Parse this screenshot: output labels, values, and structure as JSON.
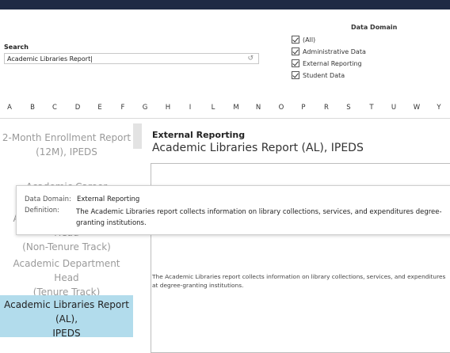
{
  "search": {
    "label": "Search",
    "value": "Academic Libraries Report",
    "reset_icon": "refresh-icon"
  },
  "domain_filter": {
    "title": "Data Domain",
    "options": [
      {
        "label": "(All)",
        "checked": true
      },
      {
        "label": "Administrative Data",
        "checked": true
      },
      {
        "label": "External Reporting",
        "checked": true
      },
      {
        "label": "Student Data",
        "checked": true
      }
    ]
  },
  "alphabet": [
    "A",
    "B",
    "C",
    "D",
    "E",
    "F",
    "G",
    "H",
    "I",
    "L",
    "M",
    "N",
    "O",
    "P",
    "R",
    "S",
    "T",
    "U",
    "W",
    "Y"
  ],
  "report_list": [
    {
      "line1": "2-Month Enrollment Report",
      "line2": "(12M), IPEDS"
    },
    {
      "line1": "Academic Career",
      "line2": ""
    },
    {
      "line1": "Academic Department Head",
      "line2": "(Non-Tenure Track)"
    },
    {
      "line1": "Academic Department Head",
      "line2": "(Tenure Track)"
    },
    {
      "line1": "Academic Libraries Report (AL),",
      "line2": "IPEDS"
    }
  ],
  "selected_index": 4,
  "detail": {
    "category": "External Reporting",
    "title": "Academic Libraries Report (AL), IPEDS",
    "description": "The Academic Libraries report collects information on library collections, services, and expenditures at degree-granting institutions."
  },
  "tooltip": {
    "domain_key": "Data Domain:",
    "domain_val": "External Reporting",
    "definition_key": "Definition:",
    "definition_val": "The Academic Libraries report collects information on library collections, services, and expenditures degree-granting institutions."
  },
  "colors": {
    "top_bar": "#1f2a44",
    "selected_row": "#b2dcec"
  }
}
